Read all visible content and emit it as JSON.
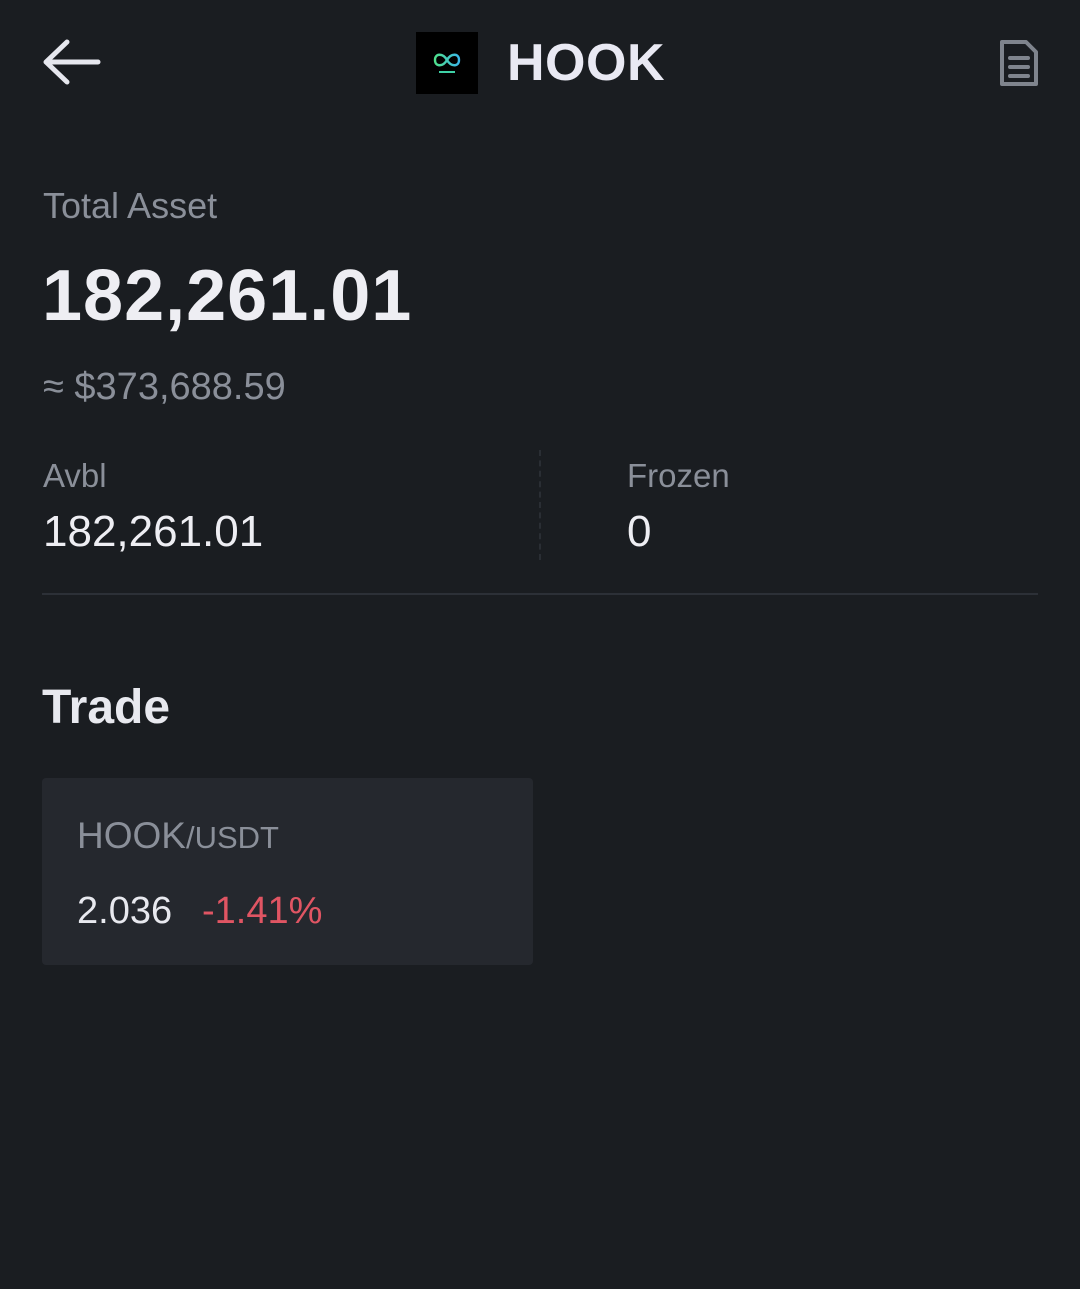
{
  "header": {
    "title": "HOOK",
    "back_icon": "arrow-left-icon",
    "logo_icon": "hooked-logo-icon",
    "record_icon": "document-icon"
  },
  "asset": {
    "total_label": "Total Asset",
    "total_value": "182,261.01",
    "usd_value": "≈ $373,688.59",
    "avbl_label": "Avbl",
    "avbl_value": "182,261.01",
    "frozen_label": "Frozen",
    "frozen_value": "0"
  },
  "trade": {
    "title": "Trade",
    "pairs": [
      {
        "base": "HOOK",
        "quote": "/USDT",
        "price": "2.036",
        "change": "-1.41%"
      }
    ]
  },
  "colors": {
    "background": "#1a1d21",
    "card": "#25282e",
    "text_primary": "#eeeef3",
    "text_secondary": "#8a8f99",
    "negative": "#e05563",
    "logo_accent": "#3fd1a6"
  }
}
